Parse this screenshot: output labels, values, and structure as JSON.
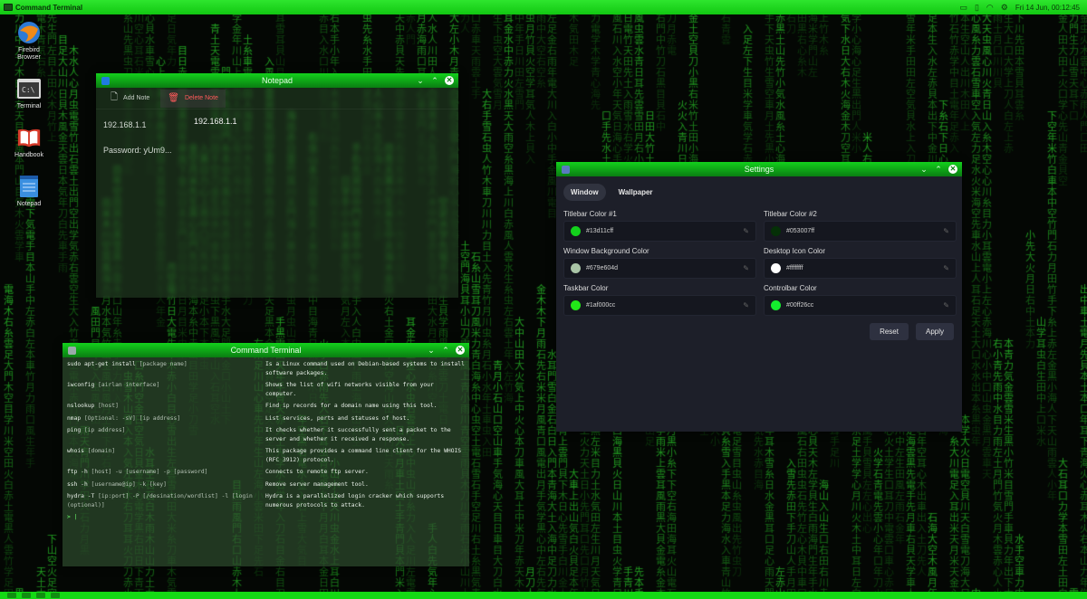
{
  "colors": {
    "accent": "#13d11c",
    "matrix": "#1fa31f",
    "settings_bg": "#1d1f29"
  },
  "topbar": {
    "title": "Command Terminal",
    "datetime": "Fri 14 Jun, 00:12:45"
  },
  "desktop_icons": [
    {
      "label": "Firebird Browser",
      "icon": "globe-icon"
    },
    {
      "label": "Terminal",
      "icon": "terminal-icon"
    },
    {
      "label": "Handbook",
      "icon": "book-icon"
    },
    {
      "label": "Notepad",
      "icon": "notepad-icon"
    }
  ],
  "notepad": {
    "title": "Notepad",
    "add_note": "Add Note",
    "delete_note": "Delete Note",
    "notes": [
      "192.168.1.1",
      "Password: yUm9..."
    ],
    "editor_line1": "192.168.1.1"
  },
  "settings": {
    "title": "Settings",
    "tabs": [
      "Window",
      "Wallpaper"
    ],
    "fields": [
      {
        "label": "Titlebar Color #1",
        "value": "#13d11cff",
        "swatch": "#13d11c"
      },
      {
        "label": "Titlebar Color #2",
        "value": "#053007ff",
        "swatch": "#053007"
      },
      {
        "label": "Window Background Color",
        "value": "#679e604d",
        "swatch": "#a9c4a6"
      },
      {
        "label": "Desktop Icon Color",
        "value": "#ffffffff",
        "swatch": "#ffffff"
      },
      {
        "label": "Taskbar Color",
        "value": "#1af000cc",
        "swatch": "#22e818"
      },
      {
        "label": "Controlbar Color",
        "value": "#00ff26cc",
        "swatch": "#14ec2e"
      }
    ],
    "reset": "Reset",
    "apply": "Apply"
  },
  "terminal": {
    "title": "Command Terminal",
    "rows": [
      {
        "cmd": "sudo apt-get install",
        "arg": "[package name]",
        "desc": "Is a Linux command used on Debian-based systems to install software packages."
      },
      {
        "cmd": "iwconfig",
        "arg": "[airlan interface]",
        "desc": "Shows the list of wifi networks visible from your computer."
      },
      {
        "cmd": "nslookup",
        "arg": "[host]",
        "desc": "Find ip records for a domain name using this tool."
      },
      {
        "cmd": "nmap",
        "arg": "[Optional: -sV] [ip address]",
        "desc": "List services, ports and statuses of host."
      },
      {
        "cmd": "ping",
        "arg": "[ip address]",
        "desc": "It checks whether it successfully sent a packet to the server and whether it received a response."
      },
      {
        "cmd": "whois",
        "arg": "[domain]",
        "desc": "This package provides a command line client for the WHOIS (RFC 3912) protocol."
      },
      {
        "cmd": "ftp -h",
        "arg": "[host] -u [username] -p [password]",
        "desc": "Connects to remote ftp server."
      },
      {
        "cmd": "ssh -h",
        "arg": "[username@ip] -k [key]",
        "desc": "Remove server management tool."
      },
      {
        "cmd": "hydra -T",
        "arg": "[ip:port] -P [/desination/wordlist] -l [login (optional)]",
        "desc": "Hydra is a parallelized login cracker which supports numerous protocols to attack."
      }
    ],
    "prompt": "> |"
  }
}
